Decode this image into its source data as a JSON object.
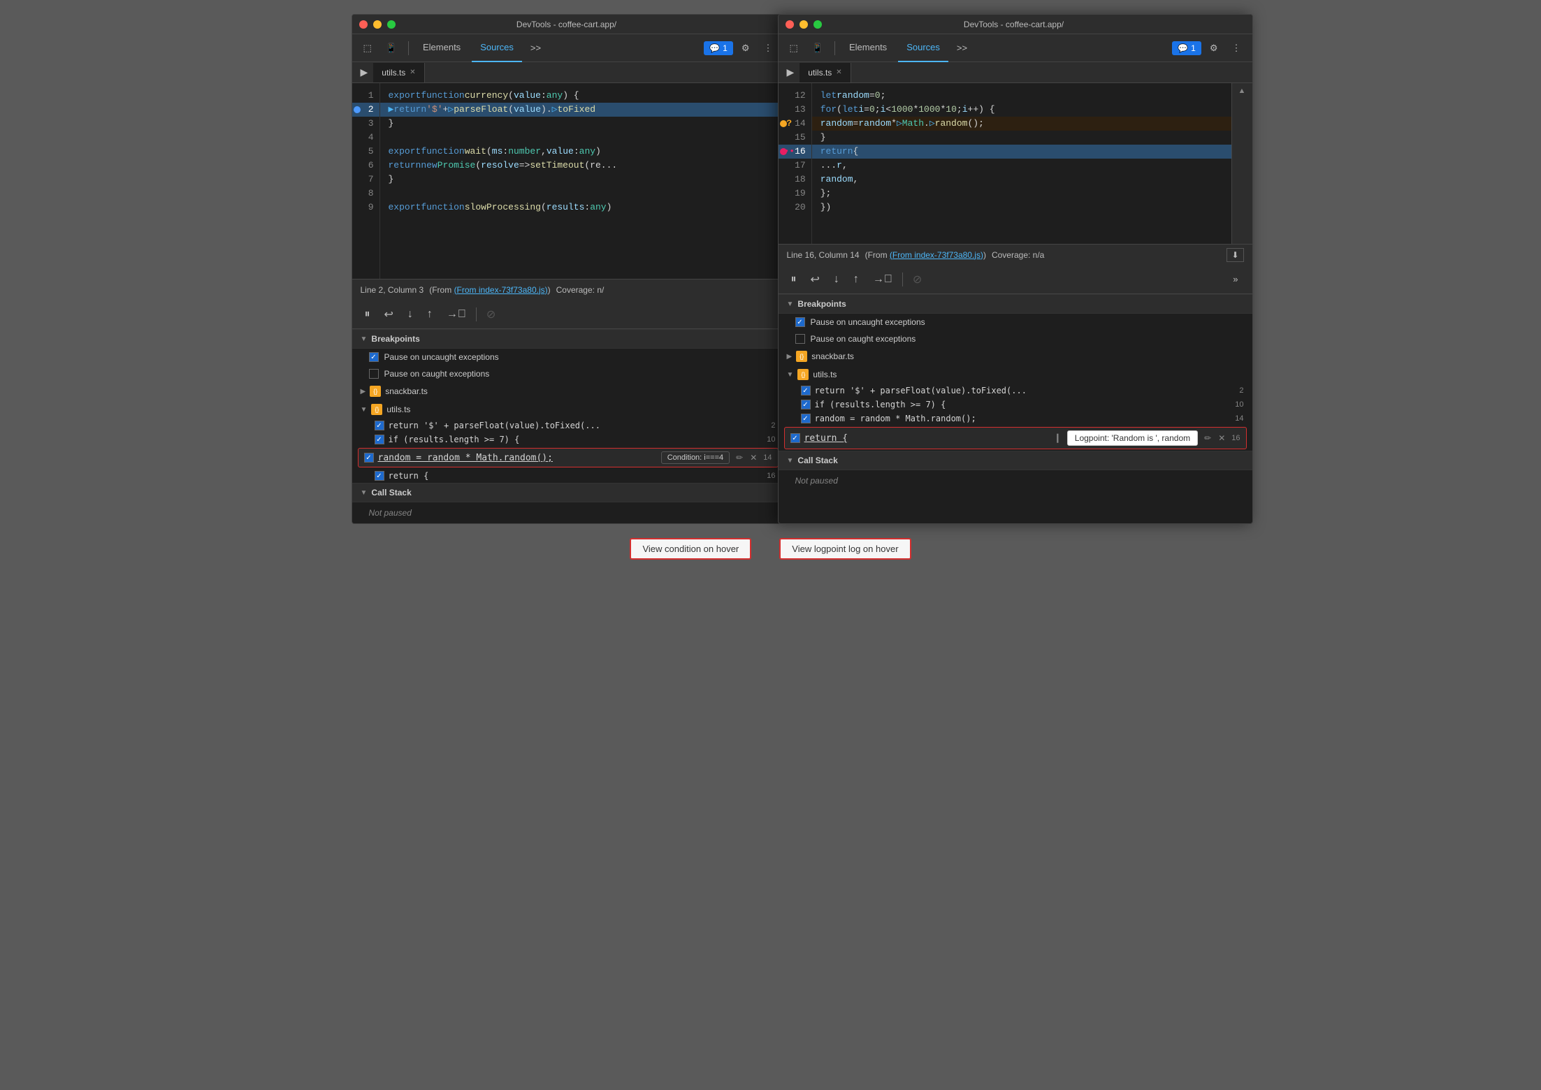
{
  "left_window": {
    "title": "DevTools - coffee-cart.app/",
    "tabs": [
      "Elements",
      "Sources",
      ">>"
    ],
    "active_tab": "Sources",
    "chat_badge": "1",
    "file_tab": "utils.ts",
    "code_lines_left": [
      {
        "num": 1,
        "content": "export function currency(value: any) {",
        "type": "normal"
      },
      {
        "num": 2,
        "content": "    return '$' + parseFloat(value).toFixed...",
        "type": "active",
        "breakpoint": "blue"
      },
      {
        "num": 3,
        "content": "}",
        "type": "normal"
      },
      {
        "num": 4,
        "content": "",
        "type": "normal"
      },
      {
        "num": 5,
        "content": "export function wait(ms: number, value: any)...",
        "type": "normal"
      },
      {
        "num": 6,
        "content": "    return new Promise(resolve => setTimeout(re...",
        "type": "normal"
      },
      {
        "num": 7,
        "content": "}",
        "type": "normal"
      },
      {
        "num": 8,
        "content": "",
        "type": "normal"
      },
      {
        "num": 9,
        "content": "export function slowProcessing(results: any)...",
        "type": "normal"
      }
    ],
    "status_line": "Line 2, Column 3",
    "status_from": "(From index-73f73a80.js)",
    "status_coverage": "Coverage: n/",
    "debug_controls": [
      "pause",
      "step-over",
      "step-into",
      "step-out",
      "continue",
      "deactivate"
    ],
    "breakpoints_section": "Breakpoints",
    "pause_uncaught": "Pause on uncaught exceptions",
    "pause_caught": "Pause on caught exceptions",
    "files": [
      "snackbar.ts",
      "utils.ts"
    ],
    "bp_items": [
      {
        "code": "return '$' + parseFloat(value).toFixed(...",
        "line": 2
      },
      {
        "code": "if (results.length >= 7) {",
        "line": 10
      },
      {
        "code": "random = random * Math.random();",
        "line": 14,
        "highlighted": true,
        "condition": "Condition: i===4"
      },
      {
        "code": "return {",
        "line": 16
      }
    ],
    "callstack_section": "Call Stack",
    "not_paused": "Not paused"
  },
  "right_window": {
    "title": "DevTools - coffee-cart.app/",
    "tabs": [
      "Elements",
      "Sources",
      ">>"
    ],
    "active_tab": "Sources",
    "chat_badge": "1",
    "file_tab": "utils.ts",
    "code_lines_right": [
      {
        "num": 12,
        "content": "        let random = 0;",
        "type": "normal"
      },
      {
        "num": 13,
        "content": "        for (let i = 0; i < 1000 * 1000 * 10; i++) {",
        "type": "normal"
      },
      {
        "num": 14,
        "content": "            random = random * Math.random();",
        "type": "condition",
        "breakpoint": "orange"
      },
      {
        "num": 15,
        "content": "        }",
        "type": "normal"
      },
      {
        "num": 16,
        "content": "        return {",
        "type": "active",
        "breakpoint": "pink"
      },
      {
        "num": 17,
        "content": "            ...r,",
        "type": "normal"
      },
      {
        "num": 18,
        "content": "            random,",
        "type": "normal"
      },
      {
        "num": 19,
        "content": "        };",
        "type": "normal"
      },
      {
        "num": 20,
        "content": "    })",
        "type": "normal"
      }
    ],
    "status_line": "Line 16, Column 14",
    "status_from": "(From index-73f73a80.js)",
    "status_coverage": "Coverage: n/a",
    "breakpoints_section": "Breakpoints",
    "pause_uncaught": "Pause on uncaught exceptions",
    "pause_caught": "Pause on caught exceptions",
    "files": [
      "snackbar.ts",
      "utils.ts"
    ],
    "bp_items": [
      {
        "code": "return '$' + parseFloat(value).toFixed(...",
        "line": 2
      },
      {
        "code": "if (results.length >= 7) {",
        "line": 10
      },
      {
        "code": "random = random * Math.random();",
        "line": 14
      },
      {
        "code": "return {",
        "line": 16,
        "highlighted": true,
        "logpoint": "Logpoint: 'Random is ', random"
      }
    ],
    "callstack_section": "Call Stack",
    "not_paused": "Not paused",
    "right_panel_label": "Not pa"
  },
  "annotations": {
    "left": "View condition on hover",
    "right": "View logpoint log on hover"
  }
}
